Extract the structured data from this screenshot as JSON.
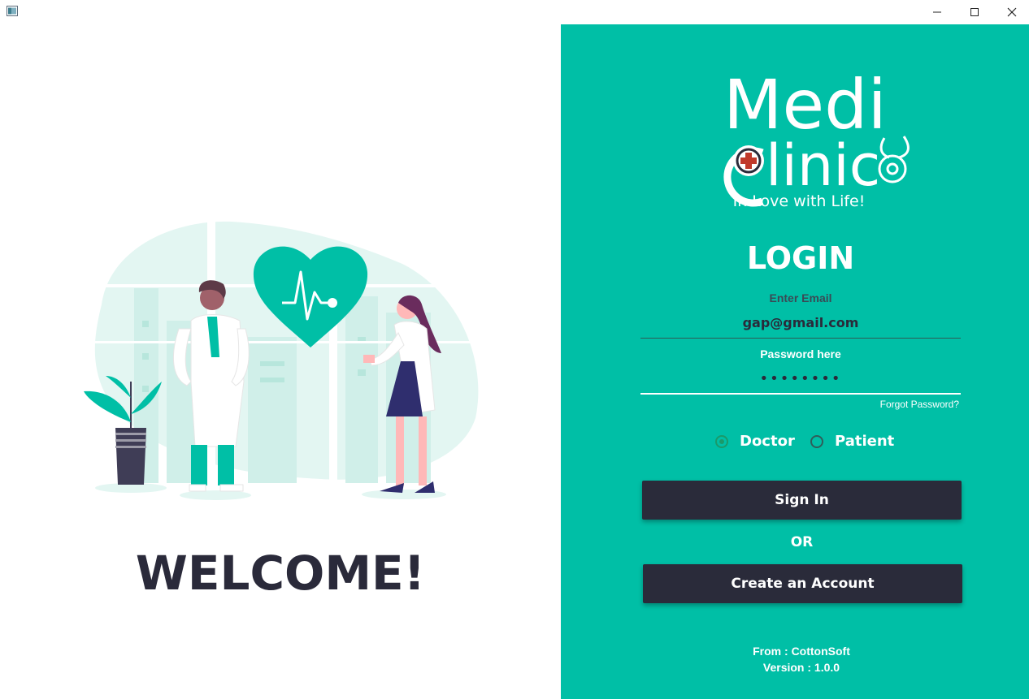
{
  "window": {
    "icon": "app-window-icon",
    "controls": [
      "minimize-icon",
      "maximize-icon",
      "close-icon"
    ]
  },
  "left": {
    "welcome": "WELCOME!"
  },
  "right": {
    "logo": {
      "line1": "Medi",
      "line2": "linic"
    },
    "tagline": "In Love with Life!",
    "login_title": "LOGIN",
    "email_label": "Enter Email",
    "email_value": "gap@gmail.com",
    "password_label": "Password here",
    "password_value": "••••••••",
    "forgot": "Forgot Password?",
    "roles": [
      {
        "label": "Doctor",
        "selected": true
      },
      {
        "label": "Patient",
        "selected": false
      }
    ],
    "signin_label": "Sign In",
    "or_label": "OR",
    "create_label": "Create an Account",
    "footer_from": "From : CottonSoft",
    "footer_version": "Version : 1.0.0"
  },
  "colors": {
    "accent": "#00bfa6",
    "button": "#2a2b3a",
    "heading": "#2a2a3a"
  }
}
